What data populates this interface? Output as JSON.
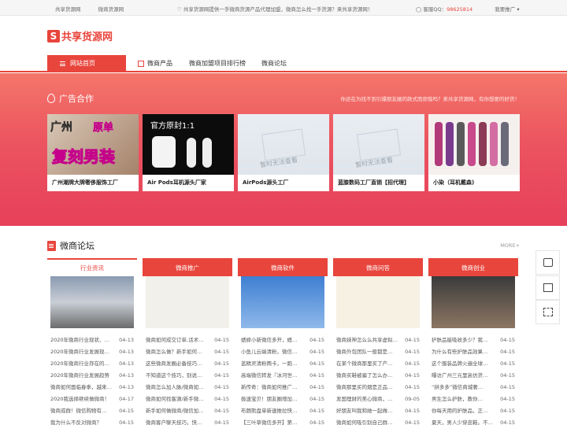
{
  "topbar": {
    "left_links": [
      "共享货源网",
      "微商货源网"
    ],
    "notice": "共享货源网提供一手微商货源产品代理加盟，微商怎么找一手货源？来共享货源网！",
    "qq_label": "客服QQ：",
    "qq_number": "98625814",
    "ad_link": "我要推广"
  },
  "header": {
    "logo_mark": "S",
    "logo_text": "共享货源网"
  },
  "nav": {
    "items": [
      "网站首页",
      "微商产品",
      "微商加盟项目排行榜",
      "微商论坛"
    ]
  },
  "ads": {
    "title": "广告合作",
    "subtitle": "你还在为找不到引爆朋友圈的款式而烦恼吗？来共享货源网，有你想要的好货！",
    "cards": [
      {
        "caption": "广州潮牌大牌奢侈服饰工厂",
        "img_text_1": "广州",
        "img_text_2": "原单",
        "img_text_3": "复刻男装"
      },
      {
        "caption": "Air Pods耳机源头厂家",
        "img_text": "官方原封1:1"
      },
      {
        "caption": "AirPods源头工厂",
        "img_text": "暂时无法查看"
      },
      {
        "caption": "蓝膝数码工厂直销【招代理】",
        "img_text": "暂时无法查看"
      },
      {
        "caption": "小染（耳机戴森)"
      }
    ]
  },
  "forum": {
    "title": "微商论坛",
    "more": "MORE+",
    "columns": [
      {
        "head": "行业资讯",
        "posts": [
          [
            "2020年微商行业现状、…",
            "04-13"
          ],
          [
            "2020年微商行业发展现…",
            "04-13"
          ],
          [
            "2020年微商行业存在的…",
            "04-13"
          ],
          [
            "2020年微商行业发展趋势",
            "04-13"
          ],
          [
            "微商如何面临春季，越来…",
            "04-13"
          ],
          [
            "2020我选择继续做微商！",
            "04-17"
          ],
          [
            "微商成群！微信购物有…",
            "04-15"
          ],
          [
            "我为什么不反对微商？",
            "04-15"
          ]
        ]
      },
      {
        "head": "微商推广",
        "posts": [
          [
            "微商如何成交订单,话术…",
            "04-15"
          ],
          [
            "微商怎么做？新手如何…",
            "04-15"
          ],
          [
            "这些微商发圈必备技巧…",
            "04-15"
          ],
          [
            "不知道这个技巧，别说…",
            "04-15"
          ],
          [
            "微商怎么加人脉/微商如…",
            "04-15"
          ],
          [
            "微商如何找客源/新手微…",
            "04-15"
          ],
          [
            "新手如何做微商/微信加…",
            "04-15"
          ],
          [
            "微商客户聊天技巧，快…",
            "04-15"
          ]
        ]
      },
      {
        "head": "微商软件",
        "posts": [
          [
            "蟋蟀小新微信多开，蟋…",
            "04-15"
          ],
          [
            "小鱼儿云端清粉，微信…",
            "04-15"
          ],
          [
            "蓝精灵清粉两卡，一跑…",
            "04-15"
          ],
          [
            "高端微信转发『冰河世…",
            "04-15"
          ],
          [
            "新传奇：微商如何推广…",
            "04-15"
          ],
          [
            "极速宝贝！朋友圈增加…",
            "04-15"
          ],
          [
            "布朗熊盘单新速推拉快…",
            "04-15"
          ],
          [
            "【三叶草微信多开】第…",
            "04-15"
          ]
        ]
      },
      {
        "head": "微商问答",
        "posts": [
          [
            "微商妹神怎么么共享虚拟…",
            "04-15"
          ],
          [
            "微商外包团队一般都是…",
            "04-15"
          ],
          [
            "在某个微商那里买了产…",
            "04-15"
          ],
          [
            "微商买鞋被骗了怎么办…",
            "04-15"
          ],
          [
            "微商那里买的烟是正品…",
            "04-15"
          ],
          [
            "发国理财的美心微商，…",
            "09-05"
          ],
          [
            "好朋友叫我和她一起做…",
            "04-15"
          ],
          [
            "微商如何吸引别自己群…",
            "04-15"
          ]
        ]
      },
      {
        "head": "微商创业",
        "posts": [
          [
            "护肤品能吸收多少？我…",
            "04-15"
          ],
          [
            "为什么有些护肤品效果…",
            "04-15"
          ],
          [
            "这个服装品牌火遍全球…",
            "04-15"
          ],
          [
            "曝访广州三元里高仿货…",
            "04-15"
          ],
          [
            "“拼多多”微信商城奢…",
            "04-15"
          ],
          [
            "男生怎么护肤，教你…",
            "04-15"
          ],
          [
            "你每天用的护肤品，正…",
            "04-15"
          ],
          [
            "夏天，男人少穿皮鞋。不…",
            "04-15"
          ]
        ]
      }
    ]
  },
  "colors": {
    "accent": "#e8453c",
    "band_top": "#f4766a",
    "band_bottom": "#e6405a"
  }
}
